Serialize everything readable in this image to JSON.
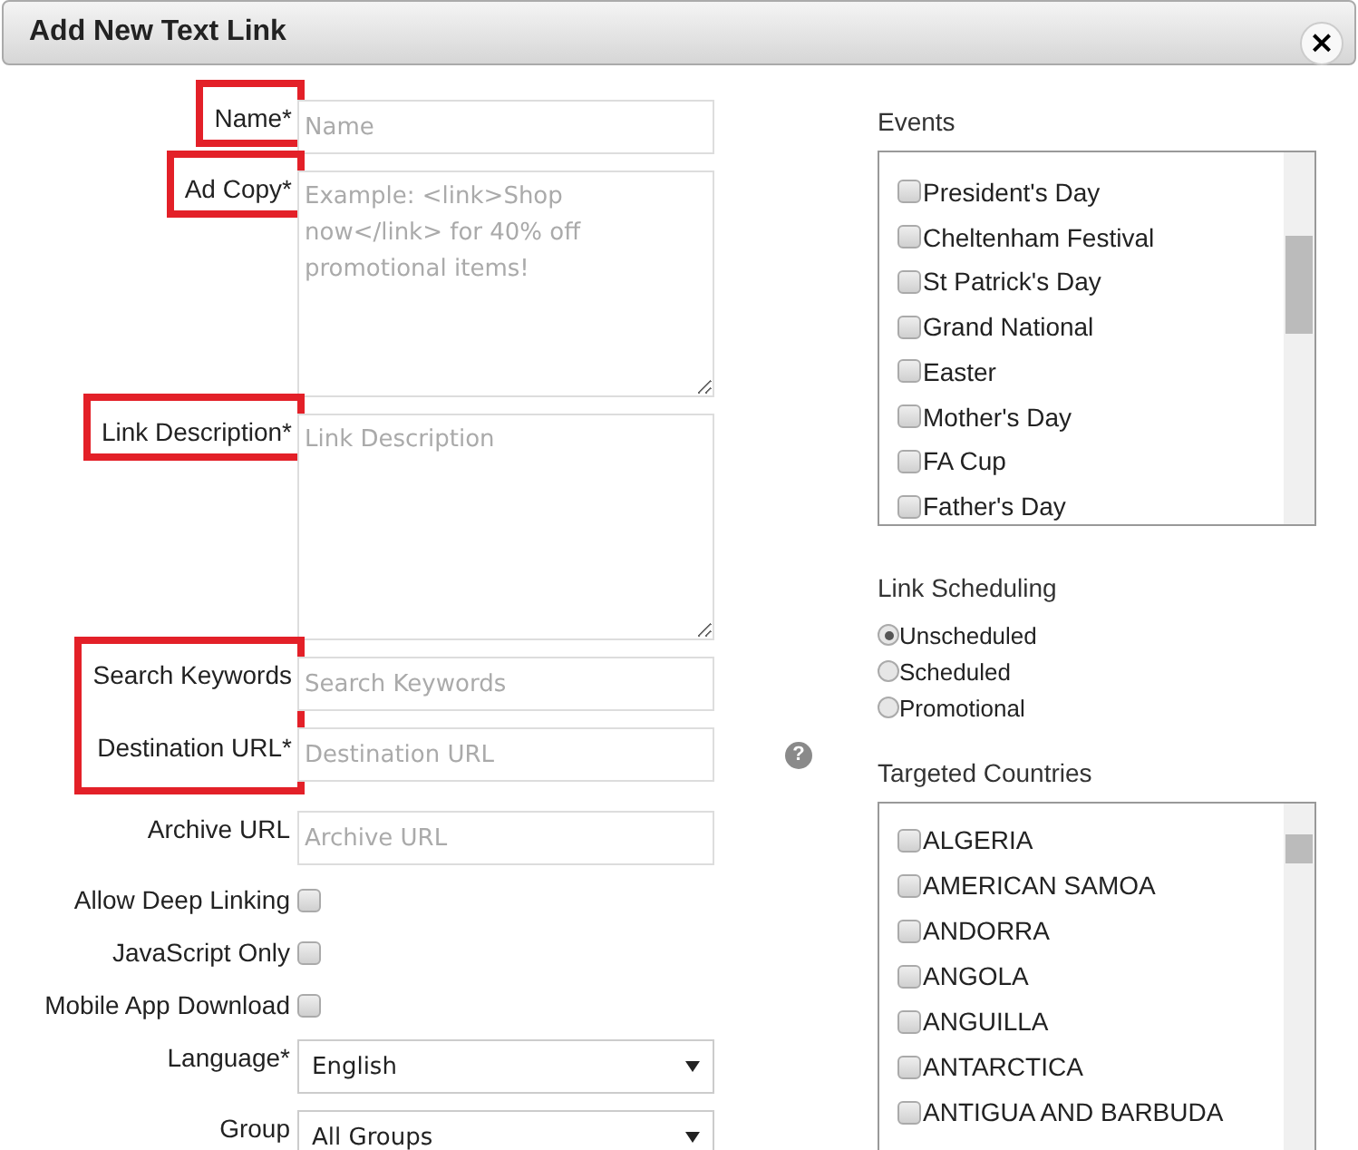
{
  "window": {
    "title": "Add New Text Link",
    "close": "×"
  },
  "form": {
    "groups": [
      {
        "highlighted": true,
        "fields": [
          {
            "kind": "text",
            "label": "Name*",
            "placeholder": "Name"
          }
        ]
      },
      {
        "highlighted": true,
        "fields": [
          {
            "kind": "textarea",
            "label": "Ad Copy*",
            "placeholder": "Example: <link>Shop now</link> for 40% off promotional items!"
          }
        ]
      },
      {
        "highlighted": true,
        "fields": [
          {
            "kind": "textarea",
            "label": "Link Description*",
            "placeholder": "Link Description"
          }
        ]
      },
      {
        "highlighted": true,
        "fields": [
          {
            "kind": "text",
            "label": "Search Keywords",
            "placeholder": "Search Keywords"
          },
          {
            "kind": "text",
            "label": "Destination URL*",
            "placeholder": "Destination URL",
            "help": "?"
          }
        ]
      },
      {
        "highlighted": false,
        "fields": [
          {
            "kind": "text",
            "label": "Archive URL",
            "placeholder": "Archive URL"
          }
        ]
      },
      {
        "highlighted": false,
        "fields": [
          {
            "kind": "checkbox",
            "label": "Allow Deep Linking",
            "checked": false
          }
        ]
      },
      {
        "highlighted": false,
        "fields": [
          {
            "kind": "checkbox",
            "label": "JavaScript Only",
            "checked": false
          }
        ]
      },
      {
        "highlighted": false,
        "fields": [
          {
            "kind": "checkbox",
            "label": "Mobile App Download",
            "checked": false
          }
        ]
      },
      {
        "highlighted": false,
        "fields": [
          {
            "kind": "select",
            "label": "Language*",
            "value": "English"
          }
        ]
      },
      {
        "highlighted": false,
        "fields": [
          {
            "kind": "select",
            "label": "Group",
            "value": "All Groups"
          }
        ]
      }
    ]
  },
  "events": {
    "title": "Events",
    "items": [
      {
        "label": "President's Day",
        "checked": false
      },
      {
        "label": "Cheltenham Festival",
        "checked": false
      },
      {
        "label": "St Patrick's Day",
        "checked": false
      },
      {
        "label": "Grand National",
        "checked": false
      },
      {
        "label": "Easter",
        "checked": false
      },
      {
        "label": "Mother's Day",
        "checked": false
      },
      {
        "label": "FA Cup",
        "checked": false
      },
      {
        "label": "Father's Day",
        "checked": false
      }
    ]
  },
  "link_scheduling": {
    "title": "Link Scheduling",
    "options": [
      {
        "label": "Unscheduled",
        "selected": true
      },
      {
        "label": "Scheduled",
        "selected": false
      },
      {
        "label": "Promotional",
        "selected": false
      }
    ]
  },
  "targeted_countries": {
    "title": "Targeted Countries",
    "items": [
      {
        "label": "ALGERIA",
        "checked": false
      },
      {
        "label": "AMERICAN SAMOA",
        "checked": false
      },
      {
        "label": "ANDORRA",
        "checked": false
      },
      {
        "label": "ANGOLA",
        "checked": false
      },
      {
        "label": "ANGUILLA",
        "checked": false
      },
      {
        "label": "ANTARCTICA",
        "checked": false
      },
      {
        "label": "ANTIGUA AND BARBUDA",
        "checked": false
      }
    ]
  }
}
